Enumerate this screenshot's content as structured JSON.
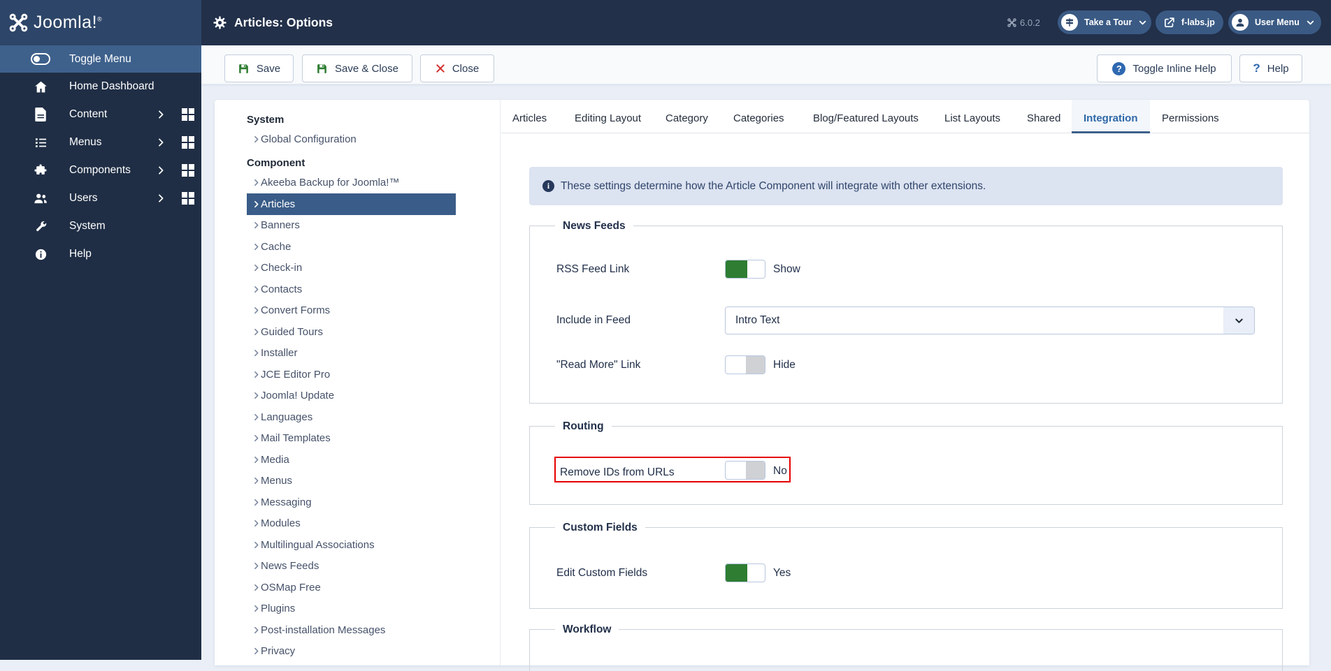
{
  "header": {
    "logo_text": "Joomla!",
    "page_title": "Articles: Options",
    "version": "6.0.2",
    "tour_button": "Take a Tour",
    "site_button": "f-labs.jp",
    "user_button": "User Menu"
  },
  "sidebar": {
    "toggle_label": "Toggle Menu",
    "items": [
      {
        "label": "Home Dashboard"
      },
      {
        "label": "Content"
      },
      {
        "label": "Menus"
      },
      {
        "label": "Components"
      },
      {
        "label": "Users"
      },
      {
        "label": "System"
      },
      {
        "label": "Help"
      }
    ]
  },
  "toolbar": {
    "save": "Save",
    "save_close": "Save & Close",
    "close": "Close",
    "toggle_inline_help": "Toggle Inline Help",
    "help": "Help"
  },
  "submenu": {
    "system_header": "System",
    "system_items": [
      "Global Configuration"
    ],
    "component_header": "Component",
    "component_items": [
      "Akeeba Backup for Joomla!™",
      "Articles",
      "Banners",
      "Cache",
      "Check-in",
      "Contacts",
      "Convert Forms",
      "Guided Tours",
      "Installer",
      "JCE Editor Pro",
      "Joomla! Update",
      "Languages",
      "Mail Templates",
      "Media",
      "Menus",
      "Messaging",
      "Modules",
      "Multilingual Associations",
      "News Feeds",
      "OSMap Free",
      "Plugins",
      "Post-installation Messages",
      "Privacy"
    ],
    "selected_item": "Articles"
  },
  "tabs": [
    "Articles",
    "Editing Layout",
    "Category",
    "Categories",
    "Blog/Featured Layouts",
    "List Layouts",
    "Shared",
    "Integration",
    "Permissions"
  ],
  "active_tab": "Integration",
  "panel": {
    "alert_text": "These settings determine how the Article Component will integrate with other extensions.",
    "news_feeds": {
      "legend": "News Feeds",
      "rss_label": "RSS Feed Link",
      "rss_value": "Show",
      "rss_state": "on",
      "include_label": "Include in Feed",
      "include_value": "Intro Text",
      "readmore_label": "\"Read More\" Link",
      "readmore_value": "Hide",
      "readmore_state": "off"
    },
    "routing": {
      "legend": "Routing",
      "remove_ids_label": "Remove IDs from URLs",
      "remove_ids_value": "No",
      "remove_ids_state": "off",
      "highlighted": true
    },
    "custom_fields": {
      "legend": "Custom Fields",
      "edit_label": "Edit Custom Fields",
      "edit_value": "Yes",
      "edit_state": "on"
    },
    "workflow": {
      "legend": "Workflow"
    }
  },
  "colors": {
    "header_bg": "#22304a",
    "logo_bg": "#2d4568",
    "sidebar_bg": "#1f2e45",
    "selection_bg": "#3a5c88",
    "accent_green": "#2e7d32",
    "highlight_red": "#e60000",
    "active_tab_text": "#2e68a8",
    "alert_bg": "#dce3f1"
  }
}
